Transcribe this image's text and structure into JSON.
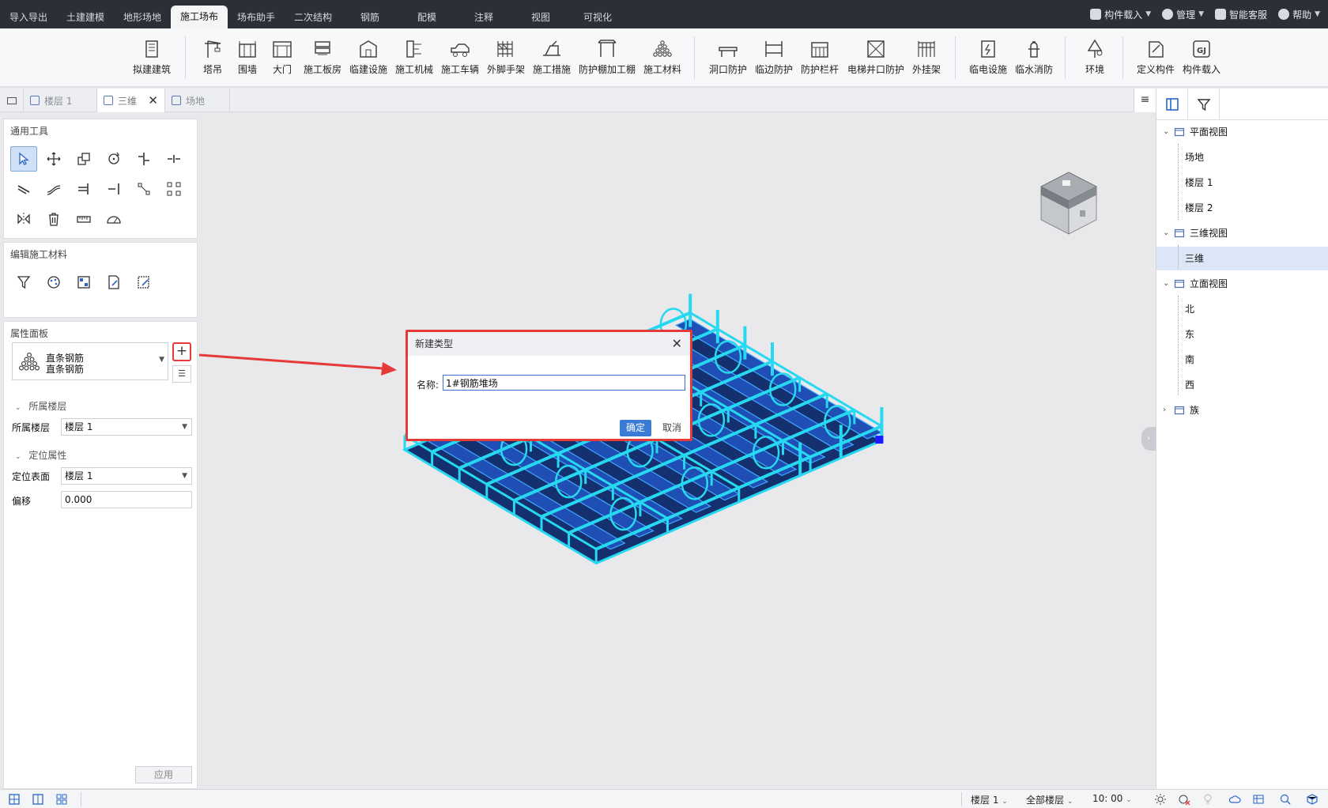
{
  "menu": {
    "tabs": [
      {
        "label": "导入导出"
      },
      {
        "label": "土建建模"
      },
      {
        "label": "地形场地"
      },
      {
        "label": "施工场布",
        "active": true
      },
      {
        "label": "场布助手"
      },
      {
        "label": "二次结构"
      },
      {
        "label": "钢筋"
      },
      {
        "label": "配模"
      },
      {
        "label": "注释"
      },
      {
        "label": "视图"
      },
      {
        "label": "可视化"
      }
    ],
    "right": {
      "component_load": "构件载入",
      "manage": "管理",
      "service": "智能客服",
      "help": "帮助"
    }
  },
  "ribbon": {
    "items": [
      {
        "label": "拟建建筑",
        "icon": "building-icon"
      },
      {
        "label": "塔吊",
        "icon": "tower-crane-icon"
      },
      {
        "label": "围墙",
        "icon": "wall-icon"
      },
      {
        "label": "大门",
        "icon": "gate-icon"
      },
      {
        "label": "施工板房",
        "icon": "prefab-house-icon"
      },
      {
        "label": "临建设施",
        "icon": "temporary-facility-icon"
      },
      {
        "label": "施工机械",
        "icon": "machinery-icon"
      },
      {
        "label": "施工车辆",
        "icon": "vehicle-icon"
      },
      {
        "label": "外脚手架",
        "icon": "scaffold-icon"
      },
      {
        "label": "施工措施",
        "icon": "measure-icon"
      },
      {
        "label": "防护棚加工棚",
        "icon": "shed-icon"
      },
      {
        "label": "施工材料",
        "icon": "material-icon"
      },
      {
        "label": "洞口防护",
        "icon": "opening-guard-icon"
      },
      {
        "label": "临边防护",
        "icon": "edge-guard-icon"
      },
      {
        "label": "防护栏杆",
        "icon": "railing-icon"
      },
      {
        "label": "电梯井口防护",
        "icon": "elevator-guard-icon"
      },
      {
        "label": "外挂架",
        "icon": "hanging-frame-icon"
      },
      {
        "label": "临电设施",
        "icon": "power-facility-icon"
      },
      {
        "label": "临水消防",
        "icon": "fire-hydrant-icon"
      },
      {
        "label": "环境",
        "icon": "tree-icon"
      },
      {
        "label": "定义构件",
        "icon": "define-component-icon"
      },
      {
        "label": "构件载入",
        "icon": "gj-load-icon"
      }
    ]
  },
  "doctabs": {
    "items": [
      {
        "label": "楼层 1"
      },
      {
        "label": "三维",
        "active": true
      },
      {
        "label": "场地"
      }
    ],
    "menu_glyph": "≡"
  },
  "left": {
    "tools_title": "通用工具",
    "edit_title": "编辑施工材料",
    "prop_title": "属性面板",
    "prop_type_line1": "直条钢筋",
    "prop_type_line2": "直条钢筋",
    "add_glyph": "+",
    "group_floor": "所属楼层",
    "floor_label": "所属楼层",
    "floor_value": "楼层 1",
    "group_position": "定位属性",
    "surface_label": "定位表面",
    "surface_value": "楼层 1",
    "offset_label": "偏移",
    "offset_value": "0.000",
    "apply": "应用"
  },
  "dialog": {
    "title": "新建类型",
    "name_label": "名称:",
    "name_value": "1#钢筋堆场",
    "ok": "确定",
    "cancel": "取消"
  },
  "right": {
    "tree": [
      {
        "label": "平面视图",
        "level": 0,
        "expanded": true
      },
      {
        "label": "场地",
        "level": 1
      },
      {
        "label": "楼层 1",
        "level": 1
      },
      {
        "label": "楼层 2",
        "level": 1
      },
      {
        "label": "三维视图",
        "level": 0,
        "expanded": true
      },
      {
        "label": "三维",
        "level": 1,
        "selected": true
      },
      {
        "label": "立面视图",
        "level": 0,
        "expanded": true
      },
      {
        "label": "北",
        "level": 1
      },
      {
        "label": "东",
        "level": 1
      },
      {
        "label": "南",
        "level": 1
      },
      {
        "label": "西",
        "level": 1
      },
      {
        "label": "族",
        "level": 0,
        "expanded": false
      }
    ]
  },
  "status": {
    "floor": "楼层 1",
    "all_floors": "全部楼层",
    "scale": "10: 00"
  },
  "colors": {
    "accent": "#3a7bd5",
    "highlight_red": "#e53a3a",
    "rebar_cyan": "#26d8f0",
    "rebar_dark": "#14306e",
    "topbar": "#2c2f38"
  }
}
